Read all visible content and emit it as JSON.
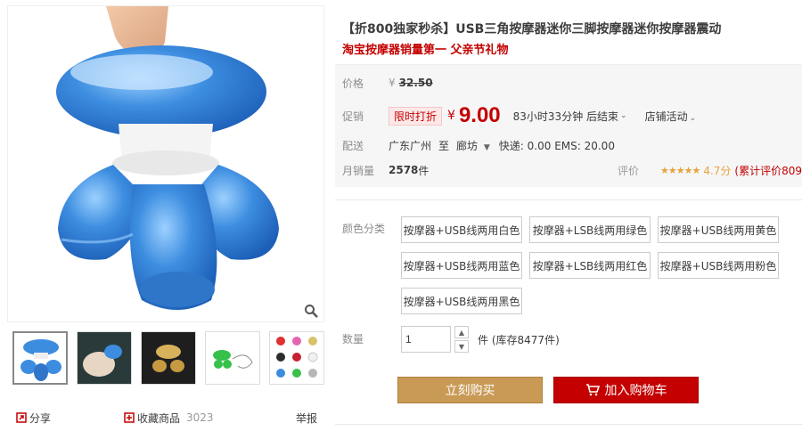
{
  "product": {
    "title": "【折800独家秒杀】USB三角按摩器迷你三脚按摩器迷你按摩器震动",
    "subtitle": "淘宝按摩器销量第一 父亲节礼物"
  },
  "price": {
    "label": "价格",
    "currency": "¥",
    "original": "32.50"
  },
  "promo": {
    "label": "促销",
    "tag": "限时打折",
    "currency": "¥",
    "price": "9.00",
    "timer": "83小时33分钟 后结束",
    "store_activity": "店铺活动"
  },
  "shipping": {
    "label": "配送",
    "from": "广东广州",
    "to_word": "至",
    "to": "廊坊",
    "fee": "快递: 0.00 EMS: 20.00"
  },
  "sales": {
    "label": "月销量",
    "count": "2578",
    "unit": "件",
    "rating_label": "评价",
    "stars": "★★★★★",
    "score": "4.7分",
    "review_count": "(累计评价809"
  },
  "sku": {
    "label": "颜色分类",
    "options": [
      "按摩器+USB线两用白色",
      "按摩器+LSB线两用绿色",
      "按摩器+USB线两用黄色",
      "按摩器+USB线两用蓝色",
      "按摩器+LSB线两用红色",
      "按摩器+USB线两用粉色",
      "按摩器+USB线两用黑色"
    ]
  },
  "quantity": {
    "label": "数量",
    "value": "1",
    "unit": "件",
    "stock": "(库存8477件)"
  },
  "buttons": {
    "buy_now": "立刻购买",
    "add_cart": "加入购物车"
  },
  "share": {
    "share_label": "分享",
    "collect_label": "收藏商品",
    "collect_count": "3023",
    "report_label": "举报"
  },
  "colors": {
    "accent_red": "#c40000",
    "buy_gold": "#c99a55",
    "product_blue": "#3c8de0",
    "star": "#e8a33d"
  }
}
